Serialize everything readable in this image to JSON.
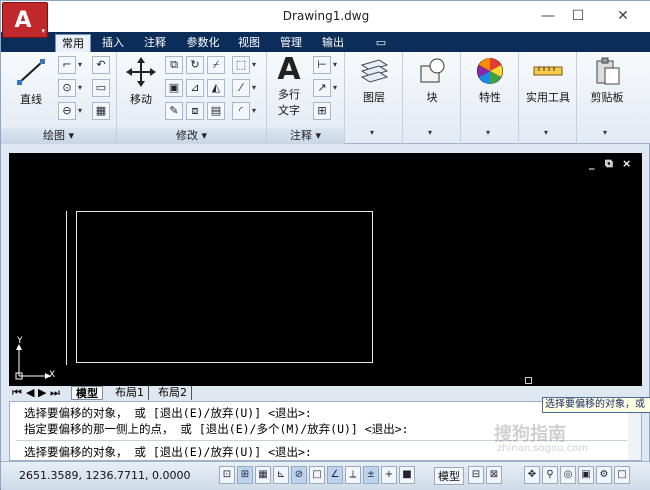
{
  "window": {
    "title": "Drawing1.dwg",
    "controls": {
      "minimize": "—",
      "maximize": "☐",
      "close": "✕"
    }
  },
  "app_button": {
    "logo": "A",
    "dropdown": "▾"
  },
  "ribbon_tabs": [
    "常用",
    "插入",
    "注释",
    "参数化",
    "视图",
    "管理",
    "输出",
    "▭"
  ],
  "ribbon": {
    "draw": {
      "title": "绘图 ▾",
      "line_label": "直线"
    },
    "modify": {
      "title": "修改 ▾",
      "move_label": "移动"
    },
    "annotation": {
      "title": "注释 ▾",
      "text_label": "多行\n文字",
      "text_line1": "多行",
      "text_line2": "文字"
    },
    "layers": {
      "label": "图层"
    },
    "block": {
      "label": "块"
    },
    "properties": {
      "label": "特性"
    },
    "utilities": {
      "label": "实用工具"
    },
    "clipboard": {
      "label": "剪贴板"
    }
  },
  "viewport": {
    "controls": [
      "_",
      "⧉",
      "×"
    ],
    "ucs_x": "X",
    "ucs_y": "Y"
  },
  "layout_tabs": [
    "模型",
    "布局1",
    "布局2"
  ],
  "layout_nav": [
    "⏮",
    "◀",
    "▶",
    "⏭"
  ],
  "tooltip": "选择要偏移的对象，或",
  "command": {
    "line1": "选择要偏移的对象， 或 [退出(E)/放弃(U)] <退出>:",
    "line2": "指定要偏移的那一侧上的点， 或 [退出(E)/多个(M)/放弃(U)] <退出>:",
    "line3": "选择要偏移的对象， 或 [退出(E)/放弃(U)] <退出>:"
  },
  "status": {
    "coords": "2651.3589, 1236.7711, 0.0000",
    "model_label": "模型"
  },
  "watermark": {
    "text": "搜狗指南",
    "url": "zhinan.sogou.com"
  }
}
